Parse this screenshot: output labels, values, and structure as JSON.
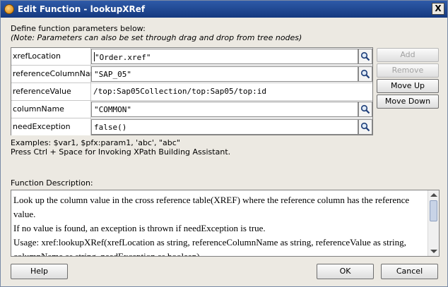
{
  "window": {
    "title": "Edit Function - lookupXRef",
    "close_label": "X"
  },
  "intro": {
    "line1": "Define function parameters below:",
    "note": "(Note: Parameters can also be set through drag and drop from tree nodes)"
  },
  "parameters": [
    {
      "name": "xrefLocation",
      "value": "\"Order.xref\"",
      "has_search": true
    },
    {
      "name": "referenceColumnName",
      "value": "\"SAP_05\"",
      "has_search": true
    },
    {
      "name": "referenceValue",
      "value": "/top:Sap05Collection/top:Sap05/top:id",
      "has_search": false
    },
    {
      "name": "columnName",
      "value": "\"COMMON\"",
      "has_search": true
    },
    {
      "name": "needException",
      "value": "false()",
      "has_search": true
    }
  ],
  "side_buttons": {
    "add": "Add",
    "remove": "Remove",
    "move_up": "Move Up",
    "move_down": "Move Down"
  },
  "examples": {
    "line1": "Examples: $var1, $pfx:param1, 'abc', \"abc\"",
    "line2": "Press Ctrl + Space for Invoking XPath Building Assistant."
  },
  "description": {
    "label": "Function Description:",
    "lines": [
      "Look up the column value in the cross reference table(XREF) where the reference column has the reference value.",
      "If no value is found, an exception is thrown if needException is true.",
      "Usage: xref:lookupXRef(xrefLocation as string, referenceColumnName as string, referenceValue as string, columnName as string, needException as boolean)"
    ]
  },
  "bottom_buttons": {
    "help": "Help",
    "ok": "OK",
    "cancel": "Cancel"
  }
}
